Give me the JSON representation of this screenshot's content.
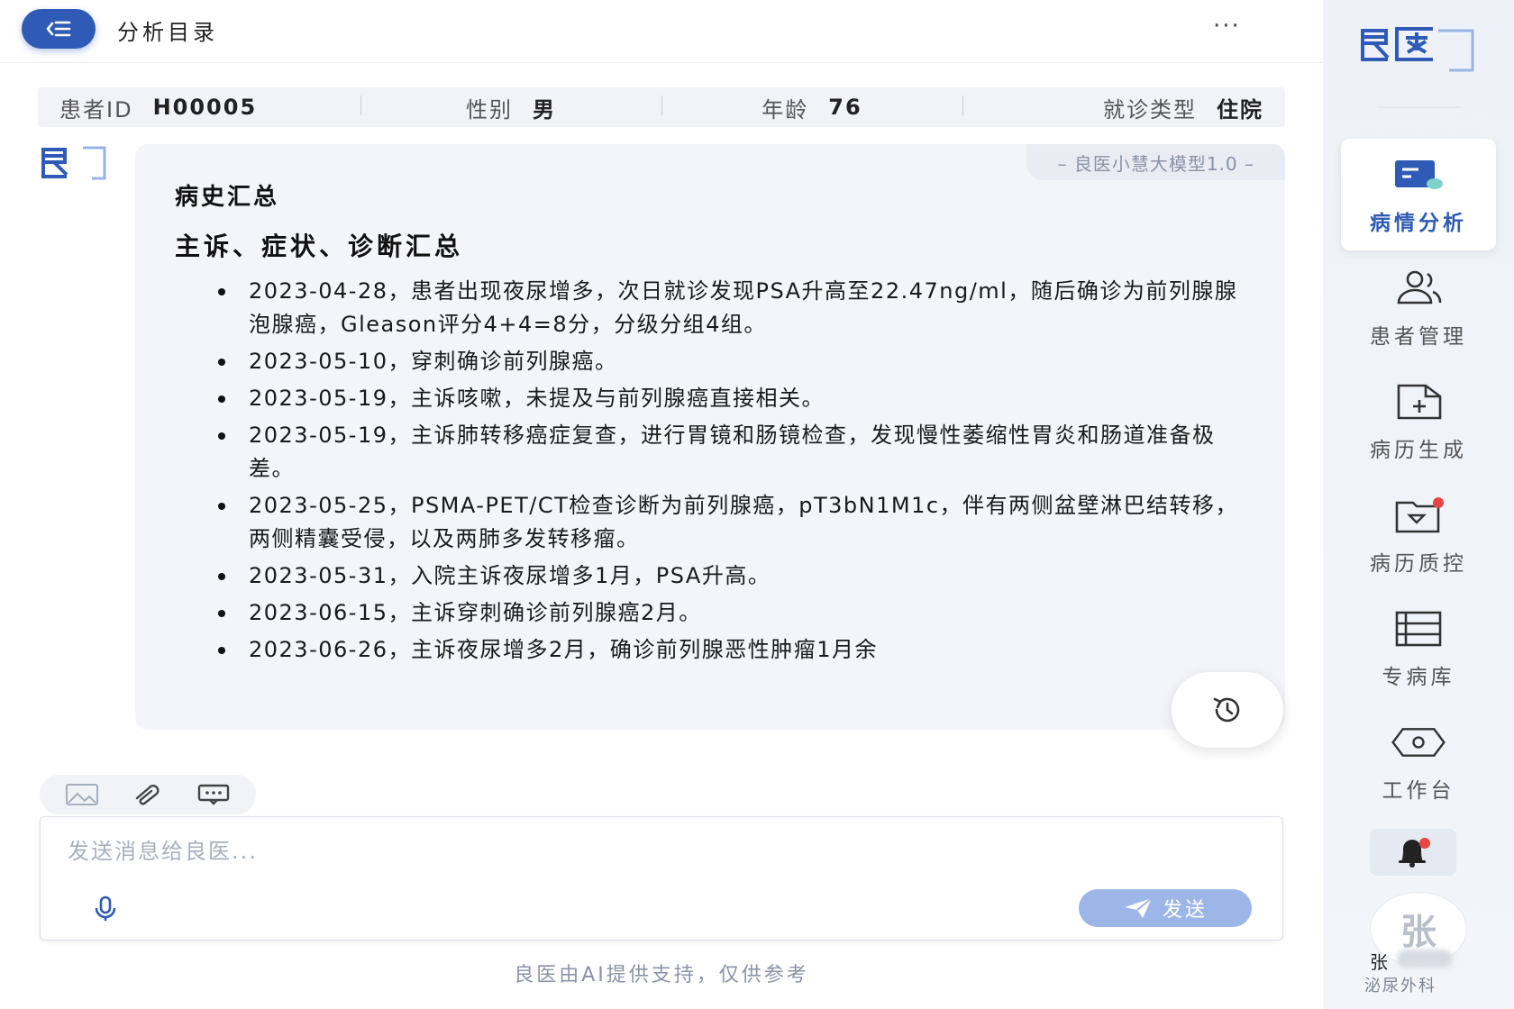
{
  "topbar": {
    "title": "分析目录",
    "more": "···"
  },
  "patient": {
    "id_label": "患者ID",
    "id_value": "H00005",
    "gender_label": "性别",
    "gender_value": "男",
    "age_label": "年龄",
    "age_value": "76",
    "visit_label": "就诊类型",
    "visit_value": "住院"
  },
  "chat": {
    "model_tag": "– 良医小慧大模型1.0 –",
    "heading": "病史汇总",
    "subheading": "主诉、症状、诊断汇总",
    "items": [
      "2023-04-28，患者出现夜尿增多，次日就诊发现PSA升高至22.47ng/ml，随后确诊为前列腺腺泡腺癌，Gleason评分4+4=8分，分级分组4组。",
      "2023-05-10，穿刺确诊前列腺癌。",
      "2023-05-19，主诉咳嗽，未提及与前列腺癌直接相关。",
      "2023-05-19，主诉肺转移癌症复查，进行胃镜和肠镜检查，发现慢性萎缩性胃炎和肠道准备极差。",
      "2023-05-25，PSMA-PET/CT检查诊断为前列腺癌，pT3bN1M1c，伴有两侧盆壁淋巴结转移，两侧精囊受侵，以及两肺多发转移瘤。",
      "2023-05-31，入院主诉夜尿增多1月，PSA升高。",
      "2023-06-15，主诉穿刺确诊前列腺癌2月。",
      "2023-06-26，主诉夜尿增多2月，确诊前列腺恶性肿瘤1月余"
    ]
  },
  "input": {
    "placeholder": "发送消息给良医...",
    "send_label": "发送",
    "disclaimer": "良医由AI提供支持，仅供参考"
  },
  "sidebar": {
    "nav": [
      {
        "label": "病情分析",
        "icon": "analysis-icon",
        "active": true
      },
      {
        "label": "患者管理",
        "icon": "users-icon"
      },
      {
        "label": "病历生成",
        "icon": "file-add-icon"
      },
      {
        "label": "病历质控",
        "icon": "folder-check-icon"
      },
      {
        "label": "专病库",
        "icon": "list-icon"
      },
      {
        "label": "工作台",
        "icon": "hexagon-icon"
      }
    ],
    "user": {
      "avatar_char": "张",
      "name": "张",
      "dept": "泌尿外科"
    }
  },
  "colors": {
    "accent": "#2f5bb7",
    "send_disabled": "#9db6e8",
    "notify": "#e84545"
  }
}
